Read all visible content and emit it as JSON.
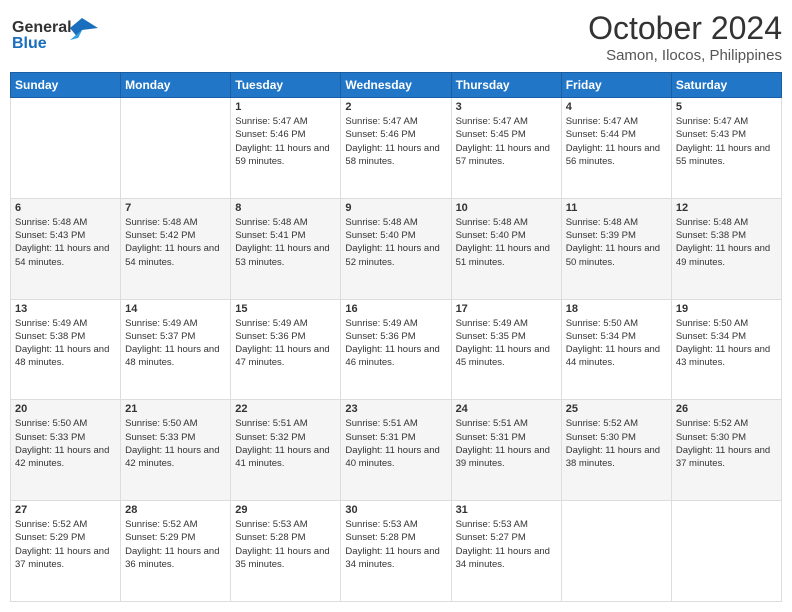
{
  "logo": {
    "line1": "General",
    "line2": "Blue"
  },
  "title": "October 2024",
  "subtitle": "Samon, Ilocos, Philippines",
  "days_header": [
    "Sunday",
    "Monday",
    "Tuesday",
    "Wednesday",
    "Thursday",
    "Friday",
    "Saturday"
  ],
  "weeks": [
    [
      {
        "day": "",
        "info": ""
      },
      {
        "day": "",
        "info": ""
      },
      {
        "day": "1",
        "sunrise": "Sunrise: 5:47 AM",
        "sunset": "Sunset: 5:46 PM",
        "daylight": "Daylight: 11 hours and 59 minutes."
      },
      {
        "day": "2",
        "sunrise": "Sunrise: 5:47 AM",
        "sunset": "Sunset: 5:46 PM",
        "daylight": "Daylight: 11 hours and 58 minutes."
      },
      {
        "day": "3",
        "sunrise": "Sunrise: 5:47 AM",
        "sunset": "Sunset: 5:45 PM",
        "daylight": "Daylight: 11 hours and 57 minutes."
      },
      {
        "day": "4",
        "sunrise": "Sunrise: 5:47 AM",
        "sunset": "Sunset: 5:44 PM",
        "daylight": "Daylight: 11 hours and 56 minutes."
      },
      {
        "day": "5",
        "sunrise": "Sunrise: 5:47 AM",
        "sunset": "Sunset: 5:43 PM",
        "daylight": "Daylight: 11 hours and 55 minutes."
      }
    ],
    [
      {
        "day": "6",
        "sunrise": "Sunrise: 5:48 AM",
        "sunset": "Sunset: 5:43 PM",
        "daylight": "Daylight: 11 hours and 54 minutes."
      },
      {
        "day": "7",
        "sunrise": "Sunrise: 5:48 AM",
        "sunset": "Sunset: 5:42 PM",
        "daylight": "Daylight: 11 hours and 54 minutes."
      },
      {
        "day": "8",
        "sunrise": "Sunrise: 5:48 AM",
        "sunset": "Sunset: 5:41 PM",
        "daylight": "Daylight: 11 hours and 53 minutes."
      },
      {
        "day": "9",
        "sunrise": "Sunrise: 5:48 AM",
        "sunset": "Sunset: 5:40 PM",
        "daylight": "Daylight: 11 hours and 52 minutes."
      },
      {
        "day": "10",
        "sunrise": "Sunrise: 5:48 AM",
        "sunset": "Sunset: 5:40 PM",
        "daylight": "Daylight: 11 hours and 51 minutes."
      },
      {
        "day": "11",
        "sunrise": "Sunrise: 5:48 AM",
        "sunset": "Sunset: 5:39 PM",
        "daylight": "Daylight: 11 hours and 50 minutes."
      },
      {
        "day": "12",
        "sunrise": "Sunrise: 5:48 AM",
        "sunset": "Sunset: 5:38 PM",
        "daylight": "Daylight: 11 hours and 49 minutes."
      }
    ],
    [
      {
        "day": "13",
        "sunrise": "Sunrise: 5:49 AM",
        "sunset": "Sunset: 5:38 PM",
        "daylight": "Daylight: 11 hours and 48 minutes."
      },
      {
        "day": "14",
        "sunrise": "Sunrise: 5:49 AM",
        "sunset": "Sunset: 5:37 PM",
        "daylight": "Daylight: 11 hours and 48 minutes."
      },
      {
        "day": "15",
        "sunrise": "Sunrise: 5:49 AM",
        "sunset": "Sunset: 5:36 PM",
        "daylight": "Daylight: 11 hours and 47 minutes."
      },
      {
        "day": "16",
        "sunrise": "Sunrise: 5:49 AM",
        "sunset": "Sunset: 5:36 PM",
        "daylight": "Daylight: 11 hours and 46 minutes."
      },
      {
        "day": "17",
        "sunrise": "Sunrise: 5:49 AM",
        "sunset": "Sunset: 5:35 PM",
        "daylight": "Daylight: 11 hours and 45 minutes."
      },
      {
        "day": "18",
        "sunrise": "Sunrise: 5:50 AM",
        "sunset": "Sunset: 5:34 PM",
        "daylight": "Daylight: 11 hours and 44 minutes."
      },
      {
        "day": "19",
        "sunrise": "Sunrise: 5:50 AM",
        "sunset": "Sunset: 5:34 PM",
        "daylight": "Daylight: 11 hours and 43 minutes."
      }
    ],
    [
      {
        "day": "20",
        "sunrise": "Sunrise: 5:50 AM",
        "sunset": "Sunset: 5:33 PM",
        "daylight": "Daylight: 11 hours and 42 minutes."
      },
      {
        "day": "21",
        "sunrise": "Sunrise: 5:50 AM",
        "sunset": "Sunset: 5:33 PM",
        "daylight": "Daylight: 11 hours and 42 minutes."
      },
      {
        "day": "22",
        "sunrise": "Sunrise: 5:51 AM",
        "sunset": "Sunset: 5:32 PM",
        "daylight": "Daylight: 11 hours and 41 minutes."
      },
      {
        "day": "23",
        "sunrise": "Sunrise: 5:51 AM",
        "sunset": "Sunset: 5:31 PM",
        "daylight": "Daylight: 11 hours and 40 minutes."
      },
      {
        "day": "24",
        "sunrise": "Sunrise: 5:51 AM",
        "sunset": "Sunset: 5:31 PM",
        "daylight": "Daylight: 11 hours and 39 minutes."
      },
      {
        "day": "25",
        "sunrise": "Sunrise: 5:52 AM",
        "sunset": "Sunset: 5:30 PM",
        "daylight": "Daylight: 11 hours and 38 minutes."
      },
      {
        "day": "26",
        "sunrise": "Sunrise: 5:52 AM",
        "sunset": "Sunset: 5:30 PM",
        "daylight": "Daylight: 11 hours and 37 minutes."
      }
    ],
    [
      {
        "day": "27",
        "sunrise": "Sunrise: 5:52 AM",
        "sunset": "Sunset: 5:29 PM",
        "daylight": "Daylight: 11 hours and 37 minutes."
      },
      {
        "day": "28",
        "sunrise": "Sunrise: 5:52 AM",
        "sunset": "Sunset: 5:29 PM",
        "daylight": "Daylight: 11 hours and 36 minutes."
      },
      {
        "day": "29",
        "sunrise": "Sunrise: 5:53 AM",
        "sunset": "Sunset: 5:28 PM",
        "daylight": "Daylight: 11 hours and 35 minutes."
      },
      {
        "day": "30",
        "sunrise": "Sunrise: 5:53 AM",
        "sunset": "Sunset: 5:28 PM",
        "daylight": "Daylight: 11 hours and 34 minutes."
      },
      {
        "day": "31",
        "sunrise": "Sunrise: 5:53 AM",
        "sunset": "Sunset: 5:27 PM",
        "daylight": "Daylight: 11 hours and 34 minutes."
      },
      {
        "day": "",
        "info": ""
      },
      {
        "day": "",
        "info": ""
      }
    ]
  ]
}
